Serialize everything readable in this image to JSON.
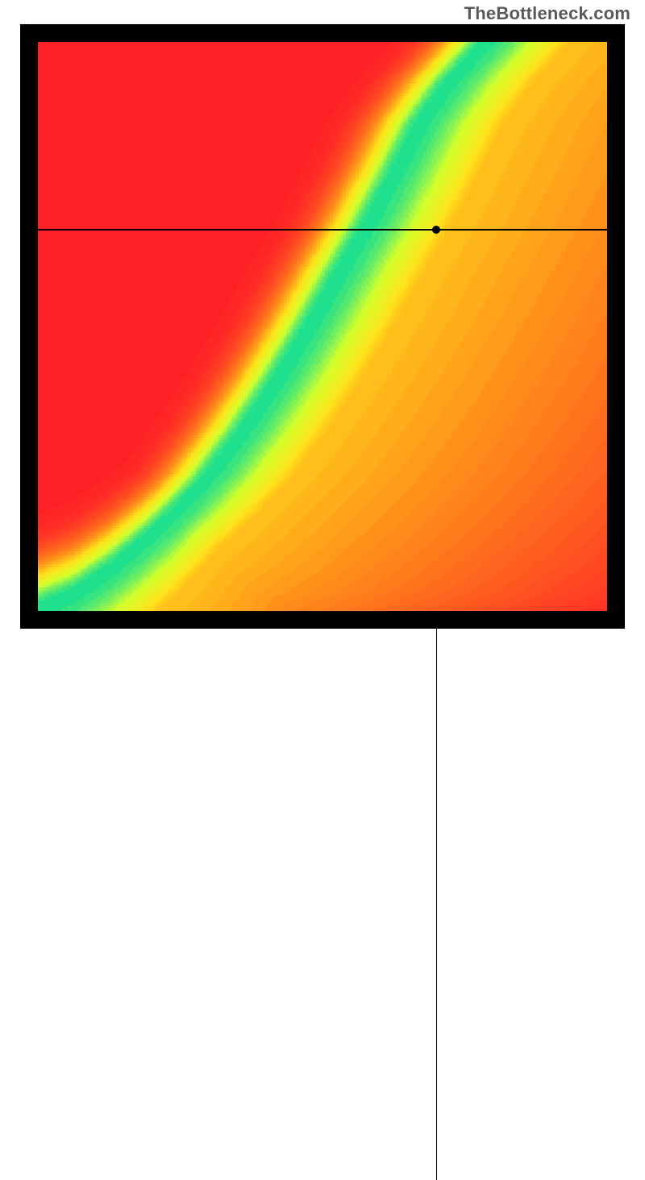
{
  "watermark": "TheBottleneck.com",
  "chart_data": {
    "type": "heatmap",
    "title": "",
    "xlabel": "",
    "ylabel": "",
    "axis_range": {
      "x": [
        0,
        1
      ],
      "y": [
        0,
        1
      ]
    },
    "grid_on": false,
    "legend_position": "none",
    "colorscale": [
      {
        "t": 0.0,
        "hex": "#ff1f27"
      },
      {
        "t": 0.38,
        "hex": "#ff8a1a"
      },
      {
        "t": 0.62,
        "hex": "#ffe21a"
      },
      {
        "t": 0.82,
        "hex": "#d4ff2c"
      },
      {
        "t": 1.0,
        "hex": "#1fe08c"
      }
    ],
    "optimal_curve": {
      "description": "Points along the green optimal ridge (x, y in axis fractions)",
      "points": [
        [
          0.0,
          0.005
        ],
        [
          0.06,
          0.03
        ],
        [
          0.12,
          0.07
        ],
        [
          0.18,
          0.12
        ],
        [
          0.24,
          0.175
        ],
        [
          0.3,
          0.24
        ],
        [
          0.36,
          0.32
        ],
        [
          0.42,
          0.41
        ],
        [
          0.48,
          0.51
        ],
        [
          0.53,
          0.6
        ],
        [
          0.58,
          0.685
        ],
        [
          0.63,
          0.78
        ],
        [
          0.67,
          0.86
        ],
        [
          0.72,
          0.93
        ],
        [
          0.77,
          0.985
        ]
      ]
    },
    "ridge_width": 0.055,
    "crosshair": {
      "x": 0.7,
      "y": 0.67
    },
    "marker": {
      "x": 0.7,
      "y": 0.67
    },
    "corners_value_estimate": {
      "bottom_left": "green-origin",
      "top_left": "red",
      "top_right": "yellow-orange",
      "bottom_right": "red"
    }
  }
}
